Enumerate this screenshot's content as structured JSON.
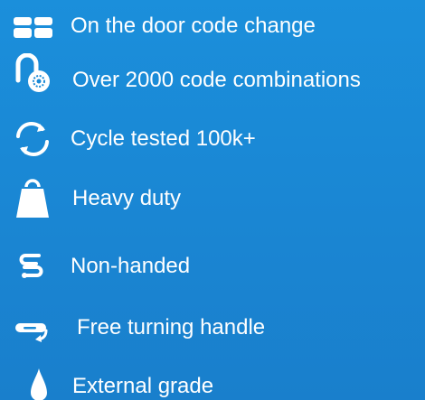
{
  "features": [
    {
      "label": "On the door code change",
      "icon": "grid-icon"
    },
    {
      "label": "Over 2000 code combinations",
      "icon": "padlock-icon"
    },
    {
      "label": "Cycle tested 100k+",
      "icon": "cycle-arrows-icon"
    },
    {
      "label": "Heavy duty",
      "icon": "weight-icon"
    },
    {
      "label": "Non-handed",
      "icon": "handles-icon"
    },
    {
      "label": "Free turning handle",
      "icon": "turning-handle-icon"
    },
    {
      "label": "External grade",
      "icon": "water-drop-icon"
    }
  ],
  "colors": {
    "background": "#1a8ad6",
    "text": "#ffffff",
    "icon": "#ffffff"
  }
}
